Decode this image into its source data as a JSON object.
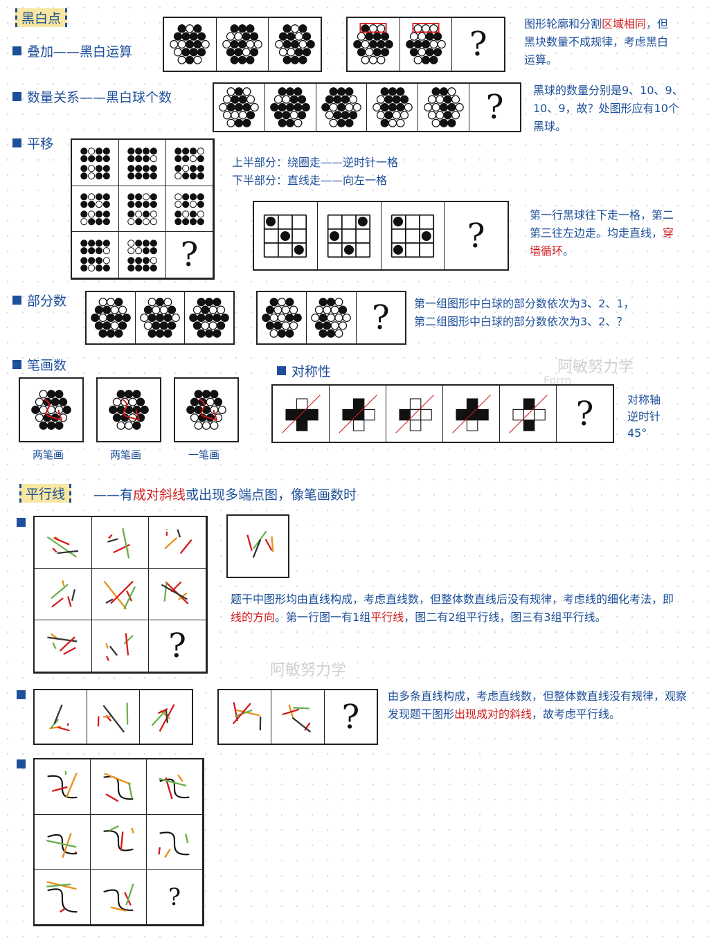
{
  "question_mark": "?",
  "sections": {
    "black_white": {
      "tag": "黑白点"
    },
    "overlay": {
      "heading": "叠加——黑白运算",
      "note_a": "图形轮廓和分割",
      "note_red": "区域相同",
      "note_b": "，但黑块数量不成规律，考虑黑白运算。"
    },
    "count": {
      "heading": "数量关系——黑白球个数",
      "note": "黑球的数量分别是9、10、9、10、9，故？处图形应有10个黑球。"
    },
    "translation": {
      "heading": "平移",
      "note_top_1": "上半部分：绕圈走——逆时针一格",
      "note_top_2": "下半部分：直线走——向左一格",
      "note_a": "第一行黑球往下走一格，第二第三往左边走。均走直线，",
      "note_red": "穿墙循环",
      "note_b": "。"
    },
    "parts": {
      "heading": "部分数",
      "note_1": "第一组图形中白球的部分数依次为3、2、1，",
      "note_2": "第二组图形中白球的部分数依次为3、2、？"
    },
    "strokes": {
      "heading": "笔画数",
      "captions": [
        "两笔画",
        "两笔画",
        "一笔画"
      ]
    },
    "symmetry": {
      "heading": "对称性",
      "note": [
        "对称轴",
        "逆时针",
        "45°"
      ]
    },
    "parallel": {
      "tag": "平行线",
      "desc_a": "——有",
      "desc_red": "成对斜线",
      "desc_b": "或出现多端点图，像笔画数时",
      "note1_a": "题干中图形均由直线构成，考虑直线数，但整体数直线后没有规律，考虑线的细化考法，即",
      "note1_red1": "线的方向",
      "note1_b": "。第一行图一有1组",
      "note1_red2": "平行线",
      "note1_c": "，图二有2组平行线，图三有3组平行线。",
      "note2_a": "由多条直线构成，考虑直线数，但整体数直线没有规律，观察发现题干图形",
      "note2_red": "出现成对的斜线",
      "note2_b": "，故考虑平行线。"
    }
  },
  "watermark": {
    "text": "阿敏努力学",
    "sub": "Form"
  },
  "colors": {
    "ink": "#1d4f9a",
    "highlight": "#d11a1a",
    "tag_bg": "#f7e7a0"
  }
}
